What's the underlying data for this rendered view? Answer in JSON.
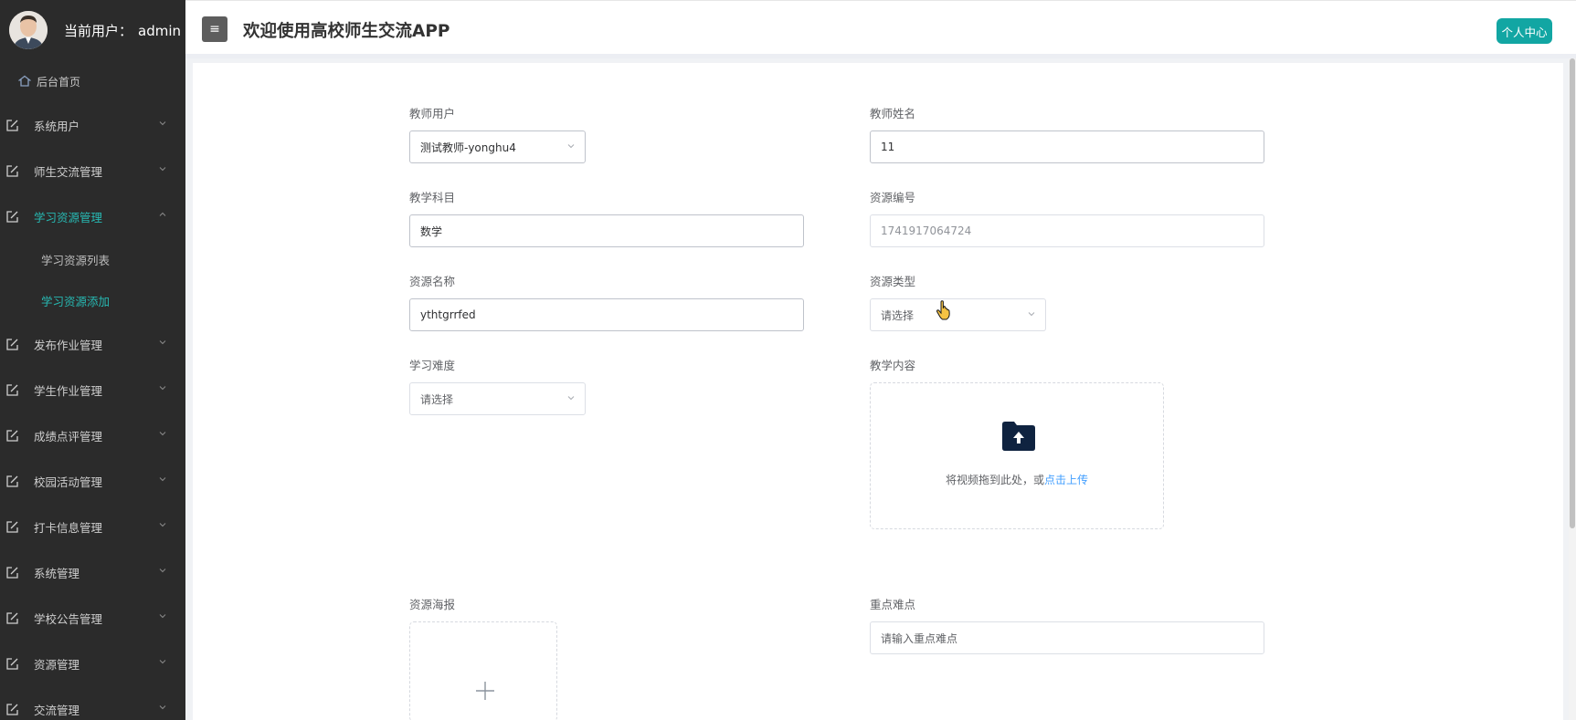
{
  "sidebar": {
    "user_label": "当前用户：",
    "user_name": "admin",
    "home": "后台首页",
    "items": [
      {
        "label": "系统用户"
      },
      {
        "label": "师生交流管理"
      },
      {
        "label": "学习资源管理"
      },
      {
        "label": "发布作业管理"
      },
      {
        "label": "学生作业管理"
      },
      {
        "label": "成绩点评管理"
      },
      {
        "label": "校园活动管理"
      },
      {
        "label": "打卡信息管理"
      },
      {
        "label": "系统管理"
      },
      {
        "label": "学校公告管理"
      },
      {
        "label": "资源管理"
      },
      {
        "label": "交流管理"
      }
    ],
    "submenu": [
      {
        "label": "学习资源列表"
      },
      {
        "label": "学习资源添加"
      }
    ]
  },
  "header": {
    "toggle_icon": "≡",
    "title": "欢迎使用高校师生交流APP",
    "profile_button": "个人中心"
  },
  "form": {
    "teacher_user": {
      "label": "教师用户",
      "value": "测试教师-yonghu4"
    },
    "teacher_name": {
      "label": "教师姓名",
      "value": "11"
    },
    "subject": {
      "label": "教学科目",
      "value": "数学"
    },
    "resource_no": {
      "label": "资源编号",
      "value": "1741917064724"
    },
    "resource_name": {
      "label": "资源名称",
      "value": "ythtgrrfed"
    },
    "resource_type": {
      "label": "资源类型",
      "placeholder": "请选择"
    },
    "difficulty": {
      "label": "学习难度",
      "placeholder": "请选择"
    },
    "teaching_content": {
      "label": "教学内容",
      "hint": "将视频拖到此处，或",
      "link": "点击上传"
    },
    "poster": {
      "label": "资源海报"
    },
    "key_points": {
      "label": "重点难点",
      "placeholder": "请输入重点难点"
    }
  },
  "colors": {
    "accent": "#27b9b3",
    "sidebar_bg": "#2b2b2b",
    "profile_btn": "#12a6a3",
    "link": "#409eff"
  }
}
